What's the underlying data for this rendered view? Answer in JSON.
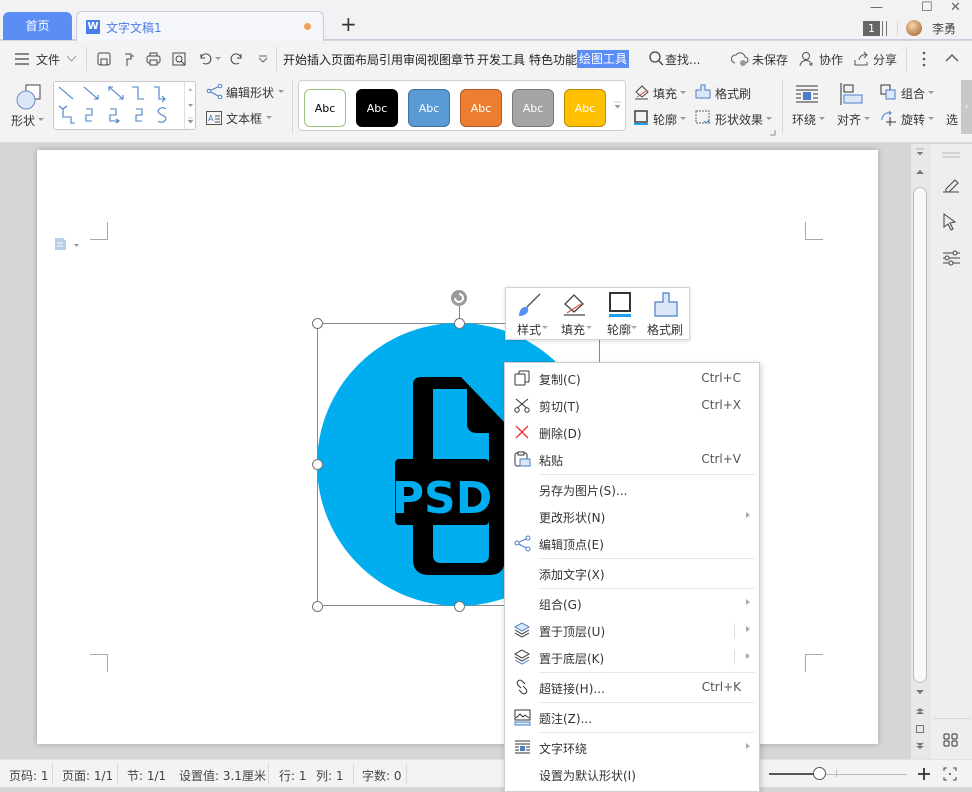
{
  "titlebar": {
    "home_tab": "首页",
    "doc_tab": {
      "title": "文字文稿1",
      "icon": "wps-writer-icon",
      "unsaved_indicator_color": "#f0a257"
    },
    "new_tab": "+",
    "window_controls": {
      "minimize": "—",
      "maximize": "☐",
      "close": "✕"
    },
    "notification_count": "1",
    "user_name": "李勇"
  },
  "menubar": {
    "file_menu": "文件",
    "quick_icons": [
      "save-icon",
      "format-painter-icon",
      "print-icon",
      "print-preview-icon",
      "undo-icon",
      "redo-icon",
      "customize-icon"
    ],
    "tabs": [
      {
        "label": "开始"
      },
      {
        "label": "插入"
      },
      {
        "label": "页面布局"
      },
      {
        "label": "引用"
      },
      {
        "label": "审阅"
      },
      {
        "label": "视图"
      },
      {
        "label": "章节"
      },
      {
        "label": "开发工具"
      },
      {
        "label": "特色功能"
      },
      {
        "label": "绘图工具",
        "active": true
      }
    ],
    "search_label": "查找...",
    "unsaved_label": "未保存",
    "collab_label": "协作",
    "share_label": "分享"
  },
  "ribbon": {
    "shape_label": "形状",
    "edit_shape": "编辑形状",
    "text_box": "文本框",
    "style_presets": [
      {
        "label": "Abc",
        "bg": "#ffffff",
        "fg": "#000000",
        "border": "#9ac37f"
      },
      {
        "label": "Abc",
        "bg": "#000000",
        "fg": "#ffffff",
        "border": "#000000"
      },
      {
        "label": "Abc",
        "bg": "#5b9bd5",
        "fg": "#ffffff",
        "border": "#41719c"
      },
      {
        "label": "Abc",
        "bg": "#ed7d31",
        "fg": "#ffffff",
        "border": "#ae5a21"
      },
      {
        "label": "Abc",
        "bg": "#a5a5a5",
        "fg": "#ffffff",
        "border": "#787878"
      },
      {
        "label": "Abc",
        "bg": "#ffc000",
        "fg": "#ffffff",
        "border": "#bc8c00"
      }
    ],
    "fill": "填充",
    "format_painter": "格式刷",
    "outline": "轮廓",
    "shape_effects": "形状效果",
    "wrap": "环绕",
    "align": "对齐",
    "group": "组合",
    "rotate": "旋转",
    "select": "选"
  },
  "mini_toolbar": {
    "items": [
      {
        "label": "样式",
        "icon": "brush-icon"
      },
      {
        "label": "填充",
        "icon": "fill-bucket-icon"
      },
      {
        "label": "轮廓",
        "icon": "outline-icon"
      },
      {
        "label": "格式刷",
        "icon": "format-painter-icon"
      }
    ]
  },
  "shape": {
    "fill_color": "#00aeef",
    "text": "PSD"
  },
  "context_menu": {
    "items": [
      {
        "label": "复制(C)",
        "shortcut": "Ctrl+C",
        "icon": "copy-icon"
      },
      {
        "label": "剪切(T)",
        "shortcut": "Ctrl+X",
        "icon": "scissors-icon"
      },
      {
        "label": "删除(D)",
        "shortcut": "",
        "icon": "delete-x-icon"
      },
      {
        "label": "粘贴",
        "shortcut": "Ctrl+V",
        "icon": "paste-icon"
      },
      {
        "label": "另存为图片(S)...",
        "shortcut": ""
      },
      {
        "label": "更改形状(N)",
        "submenu": true
      },
      {
        "label": "编辑顶点(E)",
        "icon": "edit-points-icon"
      },
      {
        "label": "添加文字(X)"
      },
      {
        "label": "组合(G)",
        "submenu": true
      },
      {
        "label": "置于顶层(U)",
        "submenu": true,
        "icon": "bring-front-icon"
      },
      {
        "label": "置于底层(K)",
        "submenu": true,
        "icon": "send-back-icon"
      },
      {
        "label": "超链接(H)...",
        "shortcut": "Ctrl+K",
        "icon": "link-icon"
      },
      {
        "label": "题注(Z)...",
        "icon": "caption-icon"
      },
      {
        "label": "文字环绕",
        "submenu": true,
        "icon": "text-wrap-icon"
      },
      {
        "label": "设置为默认形状(I)"
      }
    ]
  },
  "statusbar": {
    "page_no": "页码: 1",
    "pages": "页面: 1/1",
    "section": "节: 1/1",
    "setting": "设置值: 3.1厘米",
    "row": "行: 1",
    "col": "列: 1",
    "word_count": "字数: 0",
    "zoom_fraction": 0.36
  }
}
